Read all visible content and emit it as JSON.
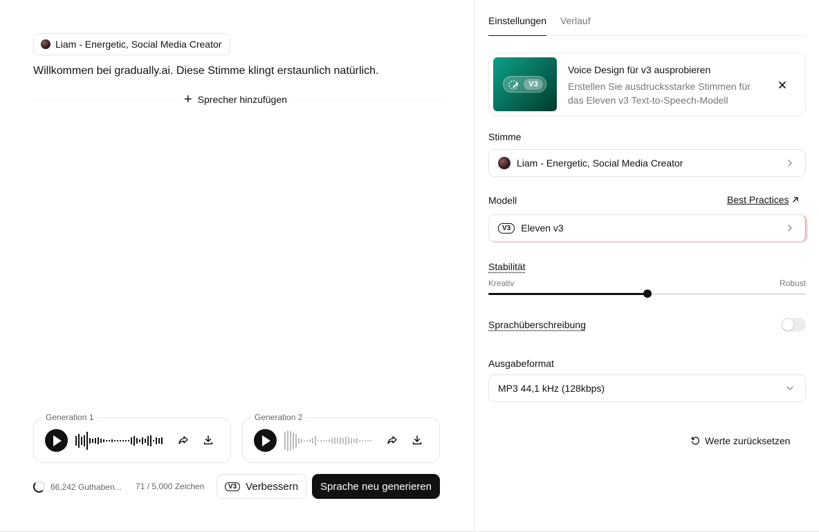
{
  "editor": {
    "speaker_name": "Liam - Energetic, Social Media Creator",
    "script_text": "Willkommen bei gradually.ai. Diese Stimme klingt erstaunlich natürlich.",
    "add_speaker_label": "Sprecher hinzufügen"
  },
  "generations": [
    {
      "label": "Generation 1",
      "state": "active"
    },
    {
      "label": "Generation 2",
      "state": "dimmed"
    }
  ],
  "footer": {
    "credits": "66,242 Guthaben...",
    "char_count": "71 / 5,000 Zeichen",
    "improve_badge": "V3",
    "improve_label": "Verbessern",
    "regenerate_label": "Sprache neu generieren"
  },
  "settings": {
    "tabs": [
      {
        "label": "Einstellungen",
        "active": true
      },
      {
        "label": "Verlauf",
        "active": false
      }
    ],
    "promo": {
      "badge": "V3",
      "title": "Voice Design für v3 ausprobieren",
      "subtitle": "Erstellen Sie ausdrucksstarke Stimmen für das Eleven v3 Text-to-Speech-Modell"
    },
    "voice_label": "Stimme",
    "voice_value": "Liam - Energetic, Social Media Creator",
    "model_label": "Modell",
    "best_practices": "Best Practices",
    "model_badge": "V3",
    "model_value": "Eleven v3",
    "stability_label": "Stabilität",
    "stability_min": "Kreativ",
    "stability_max": "Robust",
    "stability_value": 0.5,
    "speech_override_label": "Sprachüberschreibung",
    "speech_override_on": false,
    "output_format_label": "Ausgabeformat",
    "output_format_value": "MP3 44,1 kHz (128kbps)",
    "reset_label": "Werte zurücksetzen"
  },
  "colors": {
    "primary": "#111111",
    "muted": "#777777",
    "border": "#e4e4e4",
    "promo_green": "#0d9f86"
  }
}
